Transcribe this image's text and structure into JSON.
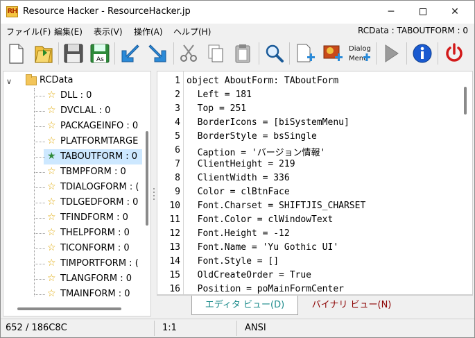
{
  "title": "Resource Hacker - ResourceHacker.jp",
  "app_icon_text": "RH",
  "window_controls": {
    "minimize": "─",
    "close": "✕"
  },
  "menu": {
    "items": [
      "ファイル(F)",
      "編集(E)",
      "表示(V)",
      "操作(A)",
      "ヘルプ(H)"
    ],
    "status": "RCData : TABOUTFORM : 0"
  },
  "toolbar": {
    "buttons": [
      "new-file",
      "open-file",
      "save",
      "save-as",
      "arrow-down-left",
      "arrow-down-right",
      "cut",
      "copy",
      "paste",
      "find",
      "add-resource",
      "add-image",
      "add-dialog",
      "run",
      "info",
      "exit"
    ],
    "dialog_icon_text": [
      "Dialog",
      "Menu"
    ],
    "save_as_badge": "As"
  },
  "tree": {
    "root": "RCData",
    "items": [
      "DLL : 0",
      "DVCLAL : 0",
      "PACKAGEINFO : 0",
      "PLATFORMTARGE",
      "TABOUTFORM : 0",
      "TBMPFORM : 0",
      "TDIALOGFORM : (",
      "TDLGEDFORM : 0",
      "TFINDFORM : 0",
      "THELPFORM : 0",
      "TICONFORM : 0",
      "TIMPORTFORM : (",
      "TLANGFORM : 0",
      "TMAINFORM : 0"
    ],
    "selected_index": 4
  },
  "editor": {
    "lines": [
      "object AboutForm: TAboutForm",
      "  Left = 181",
      "  Top = 251",
      "  BorderIcons = [biSystemMenu]",
      "  BorderStyle = bsSingle",
      "  Caption = 'バージョン情報'",
      "  ClientHeight = 219",
      "  ClientWidth = 336",
      "  Color = clBtnFace",
      "  Font.Charset = SHIFTJIS_CHARSET",
      "  Font.Color = clWindowText",
      "  Font.Height = -12",
      "  Font.Name = 'Yu Gothic UI'",
      "  Font.Style = []",
      "  OldCreateOrder = True",
      "  Position = poMainFormCenter"
    ]
  },
  "tabs": {
    "editor_view": "エディタ ビュー(D)",
    "binary_view": "バイナリ ビュー(N)"
  },
  "status": {
    "offset": "652 / 186C8C",
    "position": "1:1",
    "encoding": "ANSI"
  }
}
